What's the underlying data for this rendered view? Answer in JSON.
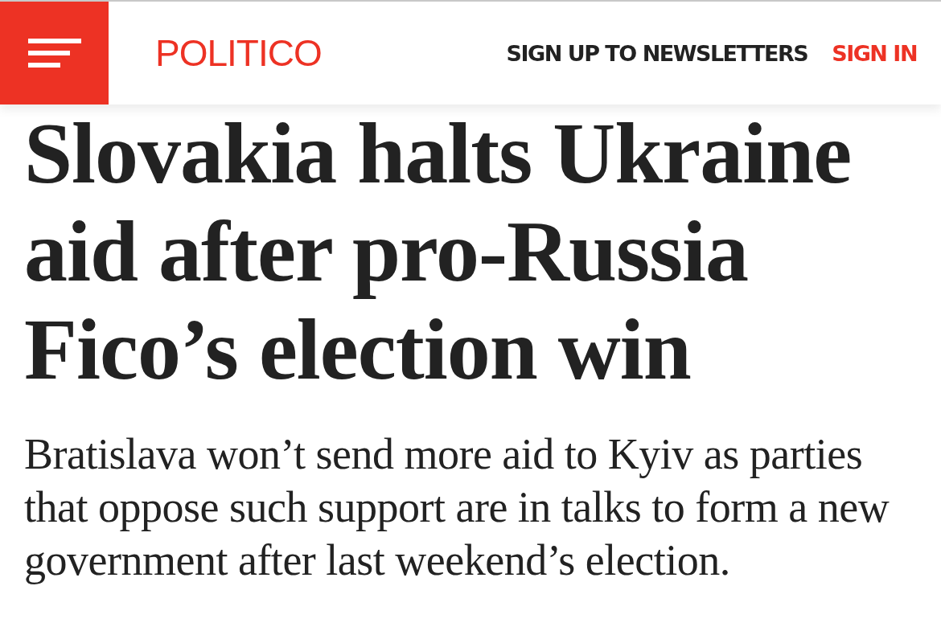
{
  "header": {
    "logo": "POLITICO",
    "links": [
      {
        "label": "SIGN UP TO NEWSLETTERS",
        "kind": "plain"
      },
      {
        "label": "SIGN IN",
        "kind": "accent"
      }
    ]
  },
  "article": {
    "headline": "Slovakia halts Ukraine aid after pro-Russia Fico’s election win",
    "dek": "Bratislava won’t send more aid to Kyiv as parties that oppose such support are in talks to form a new government after last weekend’s election."
  }
}
